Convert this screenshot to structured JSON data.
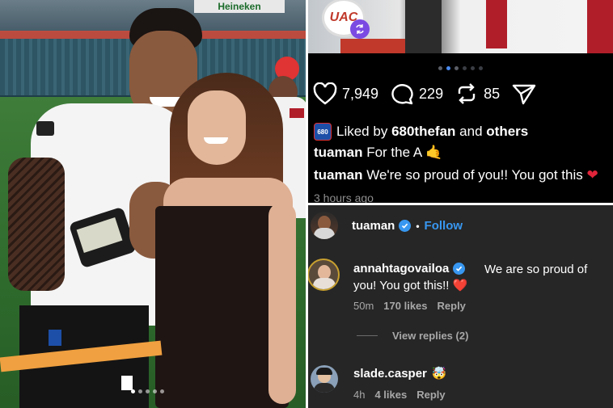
{
  "photo": {
    "stadium_sign": "Heineken",
    "carousel_total": 5,
    "carousel_active_index": 0
  },
  "post": {
    "logo_text": "UAC",
    "carousel_total": 6,
    "carousel_active_index": 1,
    "actions": {
      "likes": "7,949",
      "comments": "229",
      "reposts": "85"
    },
    "liked_by": {
      "prefix": "Liked by",
      "user": "680thefan",
      "joiner": "and",
      "suffix": "others"
    },
    "captions": [
      {
        "user": "tuaman",
        "text": "For the A",
        "emoji": "🤙"
      },
      {
        "user": "tuaman",
        "text": "We're so proud of you!! You got this",
        "emoji": "❤"
      }
    ],
    "time": "3 hours ago"
  },
  "comments": {
    "header": {
      "user": "tuaman",
      "separator": "•",
      "follow_label": "Follow"
    },
    "items": [
      {
        "user": "annahtagovailoa",
        "text": "We are so proud of you! You got this!! ❤️",
        "age": "50m",
        "likes": "170 likes",
        "reply_label": "Reply"
      },
      {
        "user": "slade.casper",
        "text": "🤯",
        "age": "4h",
        "likes": "4 likes",
        "reply_label": "Reply"
      }
    ],
    "view_replies": "View replies (2)"
  },
  "colors": {
    "accent_blue": "#3897f0",
    "dark_bg": "#000000",
    "comments_bg": "#262626",
    "carousel_active": "#4a8bf0"
  }
}
